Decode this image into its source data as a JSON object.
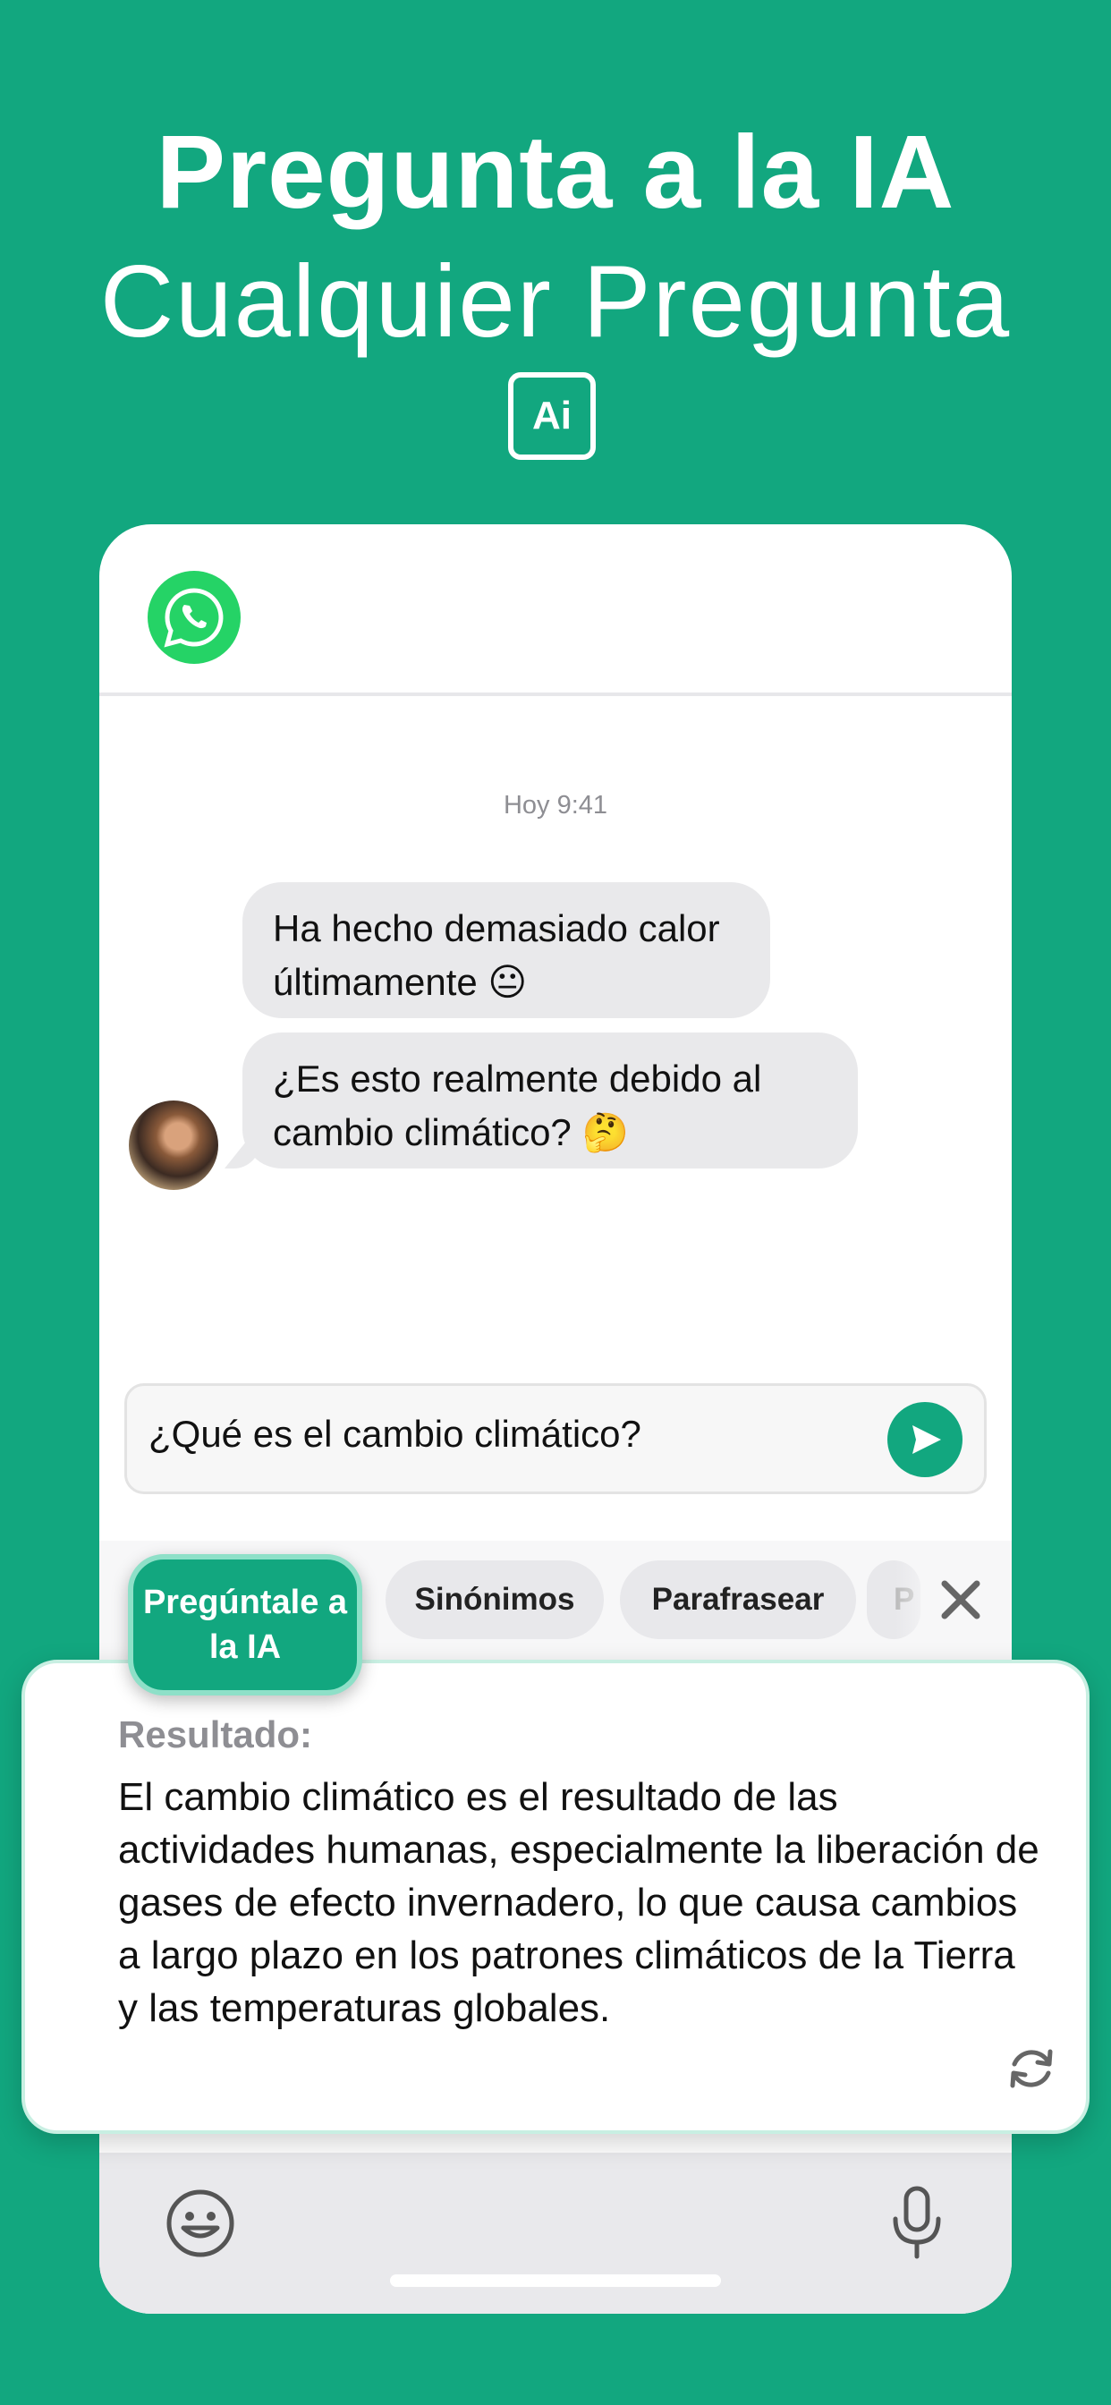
{
  "hero": {
    "title": "Pregunta a la IA",
    "subtitle": "Cualquier Pregunta",
    "badge": "Ai"
  },
  "chat": {
    "timestamp": "Hoy 9:41",
    "messages": [
      {
        "text": "Ha hecho demasiado calor últimamente 😐"
      },
      {
        "text": "¿Es esto realmente debido al cambio climático? 🤔"
      }
    ]
  },
  "input": {
    "value": "¿Qué es el cambio climático?"
  },
  "tools": {
    "ask_ai": "Pregúntale a la IA",
    "chips": [
      "Sinónimos",
      "Parafrasear",
      "P"
    ]
  },
  "result": {
    "label": "Resultado:",
    "text": "El cambio climático es el resultado de las actividades humanas, especialmente la liberación de gases de efecto invernadero, lo que causa cambios a largo plazo en los patrones climáticos de la Tierra y las temperaturas globales."
  },
  "colors": {
    "brand_green": "#12a77f",
    "whatsapp_green": "#25d366",
    "bubble_gray": "#e9e9eb"
  },
  "icons": [
    "whatsapp-logo-icon",
    "send-icon",
    "close-icon",
    "refresh-icon",
    "emoji-icon",
    "microphone-icon"
  ]
}
